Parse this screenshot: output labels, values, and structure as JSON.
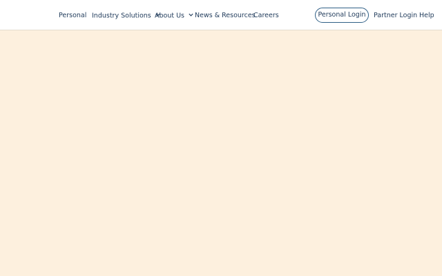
{
  "nav": {
    "personal": "Personal",
    "industry_solutions": "Industry Solutions",
    "about_us": "About Us",
    "news_resources": "News & Resources",
    "careers": "Careers",
    "personal_login": "Personal Login",
    "partner_login": "Partner Login",
    "help": "Help"
  },
  "icons": {
    "dropdown": "chevron-down-icon"
  },
  "colors": {
    "nav_text": "#1f3a5a",
    "button_border": "#2f5f86",
    "header_background": "#ffffff",
    "page_background": "#fdf0de"
  }
}
